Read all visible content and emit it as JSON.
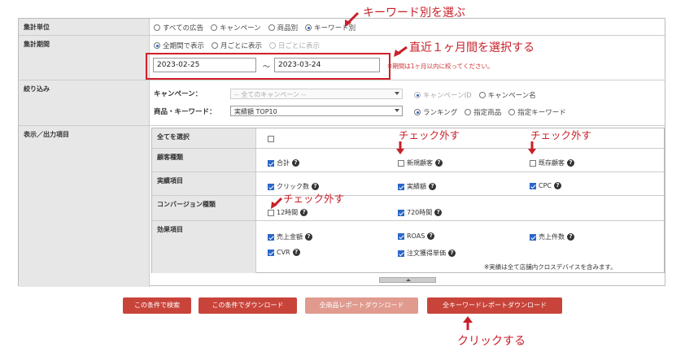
{
  "form": {
    "unit": {
      "label": "集計単位",
      "options": [
        {
          "label": "すべての広告",
          "checked": false
        },
        {
          "label": "キャンペーン",
          "checked": false
        },
        {
          "label": "商品別",
          "checked": false
        },
        {
          "label": "キーワード別",
          "checked": true
        }
      ]
    },
    "period": {
      "label": "集計期間",
      "options": [
        {
          "label": "全期間で表示",
          "checked": true
        },
        {
          "label": "月ごとに表示",
          "checked": false
        },
        {
          "label": "日ごとに表示",
          "checked": false
        }
      ],
      "start_date": "2023-02-25",
      "separator": "～",
      "end_date": "2023-03-24",
      "note": "※期間は1ヶ月以内に絞ってください。"
    },
    "filter": {
      "label": "絞り込み",
      "campaign_label": "キャンペーン：",
      "campaign_select": "-- 全てのキャンペーン --",
      "campaign_options": [
        {
          "label": "キャンペーンID",
          "checked": true
        },
        {
          "label": "キャンペーン名",
          "checked": false
        }
      ],
      "product_label": "商品・キーワード：",
      "product_select": "実績額 TOP10",
      "product_options": [
        {
          "label": "ランキング",
          "checked": true
        },
        {
          "label": "指定商品",
          "checked": false
        },
        {
          "label": "指定キーワード",
          "checked": false
        }
      ]
    },
    "output": {
      "label": "表示／出力項目",
      "select_all": "全てを選択",
      "customer_type": {
        "label": "顧客種類",
        "items": [
          {
            "label": "合計",
            "checked": true
          },
          {
            "label": "新規顧客",
            "checked": false
          },
          {
            "label": "既存顧客",
            "checked": false
          }
        ]
      },
      "results": {
        "label": "実績項目",
        "items": [
          {
            "label": "クリック数",
            "checked": true
          },
          {
            "label": "実績額",
            "checked": true
          },
          {
            "label": "CPC",
            "checked": true
          }
        ]
      },
      "conversion": {
        "label": "コンバージョン種類",
        "items": [
          {
            "label": "12時間",
            "checked": false
          },
          {
            "label": "720時間",
            "checked": true
          }
        ]
      },
      "effect": {
        "label": "効果項目",
        "items": [
          {
            "label": "売上金額",
            "checked": true
          },
          {
            "label": "ROAS",
            "checked": true
          },
          {
            "label": "売上件数",
            "checked": true
          },
          {
            "label": "CVR",
            "checked": true
          },
          {
            "label": "注文獲得単価",
            "checked": true
          }
        ]
      },
      "footnote": "※実績は全て店舗内クロスデバイスを含みます。"
    }
  },
  "buttons": {
    "search": "この条件で検索",
    "download": "この条件でダウンロード",
    "all_products": "全商品レポートダウンロード",
    "all_keywords": "全キーワードレポートダウンロード"
  },
  "annotations": {
    "select_keyword": "キーワード別を選ぶ",
    "select_month": "直近１ヶ月間を選択する",
    "uncheck_1": "チェック外す",
    "uncheck_2": "チェック外す",
    "uncheck_3": "チェック外す",
    "click": "クリックする"
  },
  "colors": {
    "accent_red": "#c8443a",
    "annotation_red": "#c8202a",
    "checkbox_blue": "#2a66c8"
  }
}
